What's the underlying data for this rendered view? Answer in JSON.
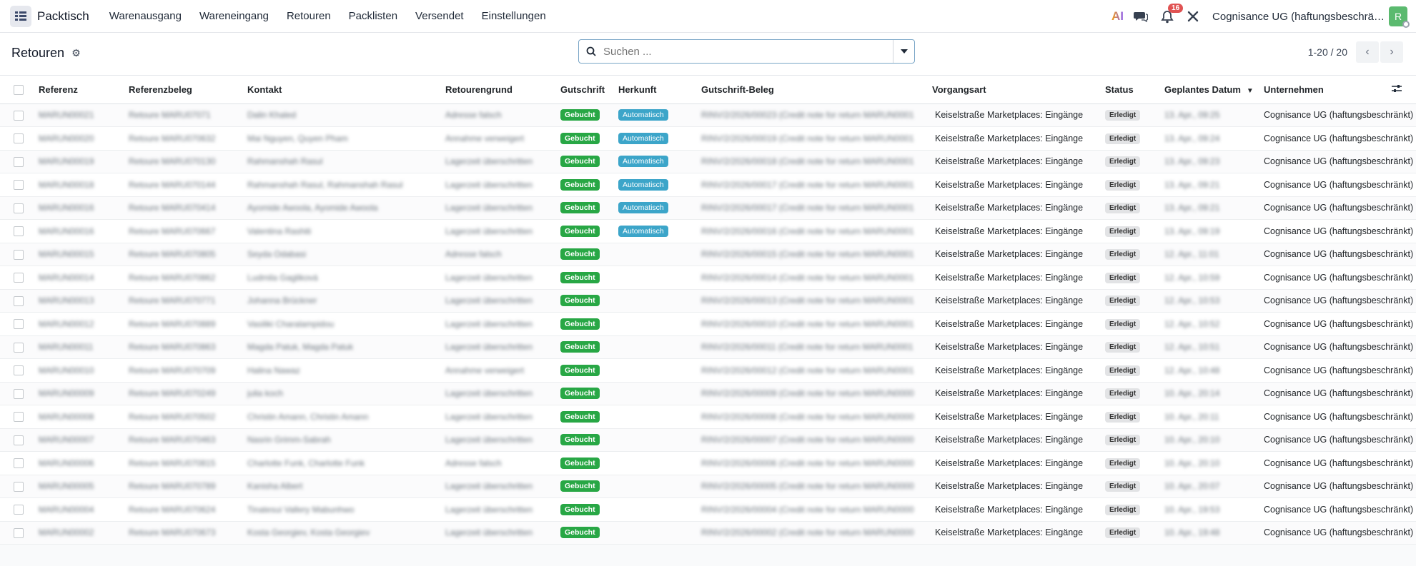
{
  "app": {
    "name": "Packtisch",
    "menu": [
      "Warenausgang",
      "Wareneingang",
      "Retouren",
      "Packlisten",
      "Versendet",
      "Einstellungen"
    ],
    "ai_label": "AI",
    "notification_count": "16",
    "company": "Cognisance UG (haftungsbeschrä…",
    "avatar_initial": "R"
  },
  "page": {
    "title": "Retouren",
    "search_placeholder": "Suchen ...",
    "pager": "1-20 / 20"
  },
  "table": {
    "headers": {
      "ref": "Referenz",
      "refbeleg": "Referenzbeleg",
      "kontakt": "Kontakt",
      "grund": "Retourengrund",
      "gutschrift": "Gutschrift",
      "herkunft": "Herkunft",
      "beleg": "Gutschrift-Beleg",
      "vorgang": "Vorgangsart",
      "status": "Status",
      "datum": "Geplantes Datum",
      "unternehmen": "Unternehmen"
    },
    "rows": [
      {
        "ref": "MARUN00021",
        "refbeleg": "Retoure MARU07071",
        "kontakt": "Dalin Khaled",
        "grund": "Adresse falsch",
        "gutschrift": "Gebucht",
        "herkunft": "Automatisch",
        "beleg": "RINV/2/2026/00023 (Credit note for return MARUN0001",
        "vorgang": "Keiselstraße Marketplaces: Eingänge",
        "status": "Erledigt",
        "datum": "13. Apr., 09:25",
        "unternehmen": "Cognisance UG (haftungsbeschränkt)"
      },
      {
        "ref": "MARUN00020",
        "refbeleg": "Retoure MARU070632",
        "kontakt": "Mai Nguyen, Quyen Pham",
        "grund": "Annahme verweigert",
        "gutschrift": "Gebucht",
        "herkunft": "Automatisch",
        "beleg": "RINV/2/2026/00019 (Credit note for return MARUN0001",
        "vorgang": "Keiselstraße Marketplaces: Eingänge",
        "status": "Erledigt",
        "datum": "13. Apr., 09:24",
        "unternehmen": "Cognisance UG (haftungsbeschränkt)"
      },
      {
        "ref": "MARUN00019",
        "refbeleg": "Retoure MARU070130",
        "kontakt": "Rahmanshah Rasul",
        "grund": "Lagerzeit überschritten",
        "gutschrift": "Gebucht",
        "herkunft": "Automatisch",
        "beleg": "RINV/2/2026/00018 (Credit note for return MARUN0001",
        "vorgang": "Keiselstraße Marketplaces: Eingänge",
        "status": "Erledigt",
        "datum": "13. Apr., 09:23",
        "unternehmen": "Cognisance UG (haftungsbeschränkt)"
      },
      {
        "ref": "MARUN00018",
        "refbeleg": "Retoure MARU070144",
        "kontakt": "Rahmanshah Rasul, Rahmanshah Rasul",
        "grund": "Lagerzeit überschritten",
        "gutschrift": "Gebucht",
        "herkunft": "Automatisch",
        "beleg": "RINV/2/2026/00017 (Credit note for return MARUN0001",
        "vorgang": "Keiselstraße Marketplaces: Eingänge",
        "status": "Erledigt",
        "datum": "13. Apr., 09:21",
        "unternehmen": "Cognisance UG (haftungsbeschränkt)"
      },
      {
        "ref": "MARUN00016",
        "refbeleg": "Retoure MARU070414",
        "kontakt": "Ayomide Awoola, Ayomide Awoola",
        "grund": "Lagerzeit überschritten",
        "gutschrift": "Gebucht",
        "herkunft": "Automatisch",
        "beleg": "RINV/2/2026/00017 (Credit note for return MARUN0001",
        "vorgang": "Keiselstraße Marketplaces: Eingänge",
        "status": "Erledigt",
        "datum": "13. Apr., 09:21",
        "unternehmen": "Cognisance UG (haftungsbeschränkt)"
      },
      {
        "ref": "MARUN00016",
        "refbeleg": "Retoure MARU070667",
        "kontakt": "Valentina Rashiti",
        "grund": "Lagerzeit überschritten",
        "gutschrift": "Gebucht",
        "herkunft": "Automatisch",
        "beleg": "RINV/2/2026/00016 (Credit note for return MARUN0001",
        "vorgang": "Keiselstraße Marketplaces: Eingänge",
        "status": "Erledigt",
        "datum": "13. Apr., 09:19",
        "unternehmen": "Cognisance UG (haftungsbeschränkt)"
      },
      {
        "ref": "MARUN00015",
        "refbeleg": "Retoure MARU070805",
        "kontakt": "Seyda Odabasi",
        "grund": "Adresse falsch",
        "gutschrift": "Gebucht",
        "herkunft": "",
        "beleg": "RINV/2/2026/00015 (Credit note for return MARUN0001",
        "vorgang": "Keiselstraße Marketplaces: Eingänge",
        "status": "Erledigt",
        "datum": "12. Apr., 11:01",
        "unternehmen": "Cognisance UG (haftungsbeschränkt)"
      },
      {
        "ref": "MARUN00014",
        "refbeleg": "Retoure MARU070862",
        "kontakt": "Ludmila Gagliková",
        "grund": "Lagerzeit überschritten",
        "gutschrift": "Gebucht",
        "herkunft": "",
        "beleg": "RINV/2/2026/00014 (Credit note for return MARUN0001",
        "vorgang": "Keiselstraße Marketplaces: Eingänge",
        "status": "Erledigt",
        "datum": "12. Apr., 10:59",
        "unternehmen": "Cognisance UG (haftungsbeschränkt)"
      },
      {
        "ref": "MARUN00013",
        "refbeleg": "Retoure MARU070771",
        "kontakt": "Johanna Brückner",
        "grund": "Lagerzeit überschritten",
        "gutschrift": "Gebucht",
        "herkunft": "",
        "beleg": "RINV/2/2026/00013 (Credit note for return MARUN0001",
        "vorgang": "Keiselstraße Marketplaces: Eingänge",
        "status": "Erledigt",
        "datum": "12. Apr., 10:53",
        "unternehmen": "Cognisance UG (haftungsbeschränkt)"
      },
      {
        "ref": "MARUN00012",
        "refbeleg": "Retoure MARU070889",
        "kontakt": "Vasiliki Charalampidou",
        "grund": "Lagerzeit überschritten",
        "gutschrift": "Gebucht",
        "herkunft": "",
        "beleg": "RINV/2/2026/00010 (Credit note for return MARUN0001",
        "vorgang": "Keiselstraße Marketplaces: Eingänge",
        "status": "Erledigt",
        "datum": "12. Apr., 10:52",
        "unternehmen": "Cognisance UG (haftungsbeschränkt)"
      },
      {
        "ref": "MARUN00011",
        "refbeleg": "Retoure MARU070863",
        "kontakt": "Magda Patuk, Magda Patuk",
        "grund": "Lagerzeit überschritten",
        "gutschrift": "Gebucht",
        "herkunft": "",
        "beleg": "RINV/2/2026/00011 (Credit note for return MARUN0001",
        "vorgang": "Keiselstraße Marketplaces: Eingänge",
        "status": "Erledigt",
        "datum": "12. Apr., 10:51",
        "unternehmen": "Cognisance UG (haftungsbeschränkt)"
      },
      {
        "ref": "MARUN00010",
        "refbeleg": "Retoure MARU070709",
        "kontakt": "Halina Nawaz",
        "grund": "Annahme verweigert",
        "gutschrift": "Gebucht",
        "herkunft": "",
        "beleg": "RINV/2/2026/00012 (Credit note for return MARUN0001",
        "vorgang": "Keiselstraße Marketplaces: Eingänge",
        "status": "Erledigt",
        "datum": "12. Apr., 10:48",
        "unternehmen": "Cognisance UG (haftungsbeschränkt)"
      },
      {
        "ref": "MARUN00009",
        "refbeleg": "Retoure MARU070249",
        "kontakt": "julia koch",
        "grund": "Lagerzeit überschritten",
        "gutschrift": "Gebucht",
        "herkunft": "",
        "beleg": "RINV/2/2026/00009 (Credit note for return MARUN0000",
        "vorgang": "Keiselstraße Marketplaces: Eingänge",
        "status": "Erledigt",
        "datum": "10. Apr., 20:14",
        "unternehmen": "Cognisance UG (haftungsbeschränkt)"
      },
      {
        "ref": "MARUN00008",
        "refbeleg": "Retoure MARU070502",
        "kontakt": "Christin Amann, Christin Amann",
        "grund": "Lagerzeit überschritten",
        "gutschrift": "Gebucht",
        "herkunft": "",
        "beleg": "RINV/2/2026/00008 (Credit note for return MARUN0000",
        "vorgang": "Keiselstraße Marketplaces: Eingänge",
        "status": "Erledigt",
        "datum": "10. Apr., 20:11",
        "unternehmen": "Cognisance UG (haftungsbeschränkt)"
      },
      {
        "ref": "MARUN00007",
        "refbeleg": "Retoure MARU070463",
        "kontakt": "Nasrin Grimm-Sabrah",
        "grund": "Lagerzeit überschritten",
        "gutschrift": "Gebucht",
        "herkunft": "",
        "beleg": "RINV/2/2026/00007 (Credit note for return MARUN0000",
        "vorgang": "Keiselstraße Marketplaces: Eingänge",
        "status": "Erledigt",
        "datum": "10. Apr., 20:10",
        "unternehmen": "Cognisance UG (haftungsbeschränkt)"
      },
      {
        "ref": "MARUN00006",
        "refbeleg": "Retoure MARU070815",
        "kontakt": "Charlotte Funk, Charlotte Funk",
        "grund": "Adresse falsch",
        "gutschrift": "Gebucht",
        "herkunft": "",
        "beleg": "RINV/2/2026/00006 (Credit note for return MARUN0000",
        "vorgang": "Keiselstraße Marketplaces: Eingänge",
        "status": "Erledigt",
        "datum": "10. Apr., 20:10",
        "unternehmen": "Cognisance UG (haftungsbeschränkt)"
      },
      {
        "ref": "MARUN00005",
        "refbeleg": "Retoure MARU070789",
        "kontakt": "Kanisha Albert",
        "grund": "Lagerzeit überschritten",
        "gutschrift": "Gebucht",
        "herkunft": "",
        "beleg": "RINV/2/2026/00005 (Credit note for return MARUN0000",
        "vorgang": "Keiselstraße Marketplaces: Eingänge",
        "status": "Erledigt",
        "datum": "10. Apr., 20:07",
        "unternehmen": "Cognisance UG (haftungsbeschränkt)"
      },
      {
        "ref": "MARUN00004",
        "refbeleg": "Retoure MARU070624",
        "kontakt": "Tinatesui Vallery Mabunhwo",
        "grund": "Lagerzeit überschritten",
        "gutschrift": "Gebucht",
        "herkunft": "",
        "beleg": "RINV/2/2026/00004 (Credit note for return MARUN0000",
        "vorgang": "Keiselstraße Marketplaces: Eingänge",
        "status": "Erledigt",
        "datum": "10. Apr., 19:53",
        "unternehmen": "Cognisance UG (haftungsbeschränkt)"
      },
      {
        "ref": "MARUN00002",
        "refbeleg": "Retoure MARU070673",
        "kontakt": "Kosta Georgiev, Kosta Georgiev",
        "grund": "Lagerzeit überschritten",
        "gutschrift": "Gebucht",
        "herkunft": "",
        "beleg": "RINV/2/2026/00002 (Credit note for return MARUN0000",
        "vorgang": "Keiselstraße Marketplaces: Eingänge",
        "status": "Erledigt",
        "datum": "10. Apr., 19:48",
        "unternehmen": "Cognisance UG (haftungsbeschränkt)"
      }
    ]
  }
}
